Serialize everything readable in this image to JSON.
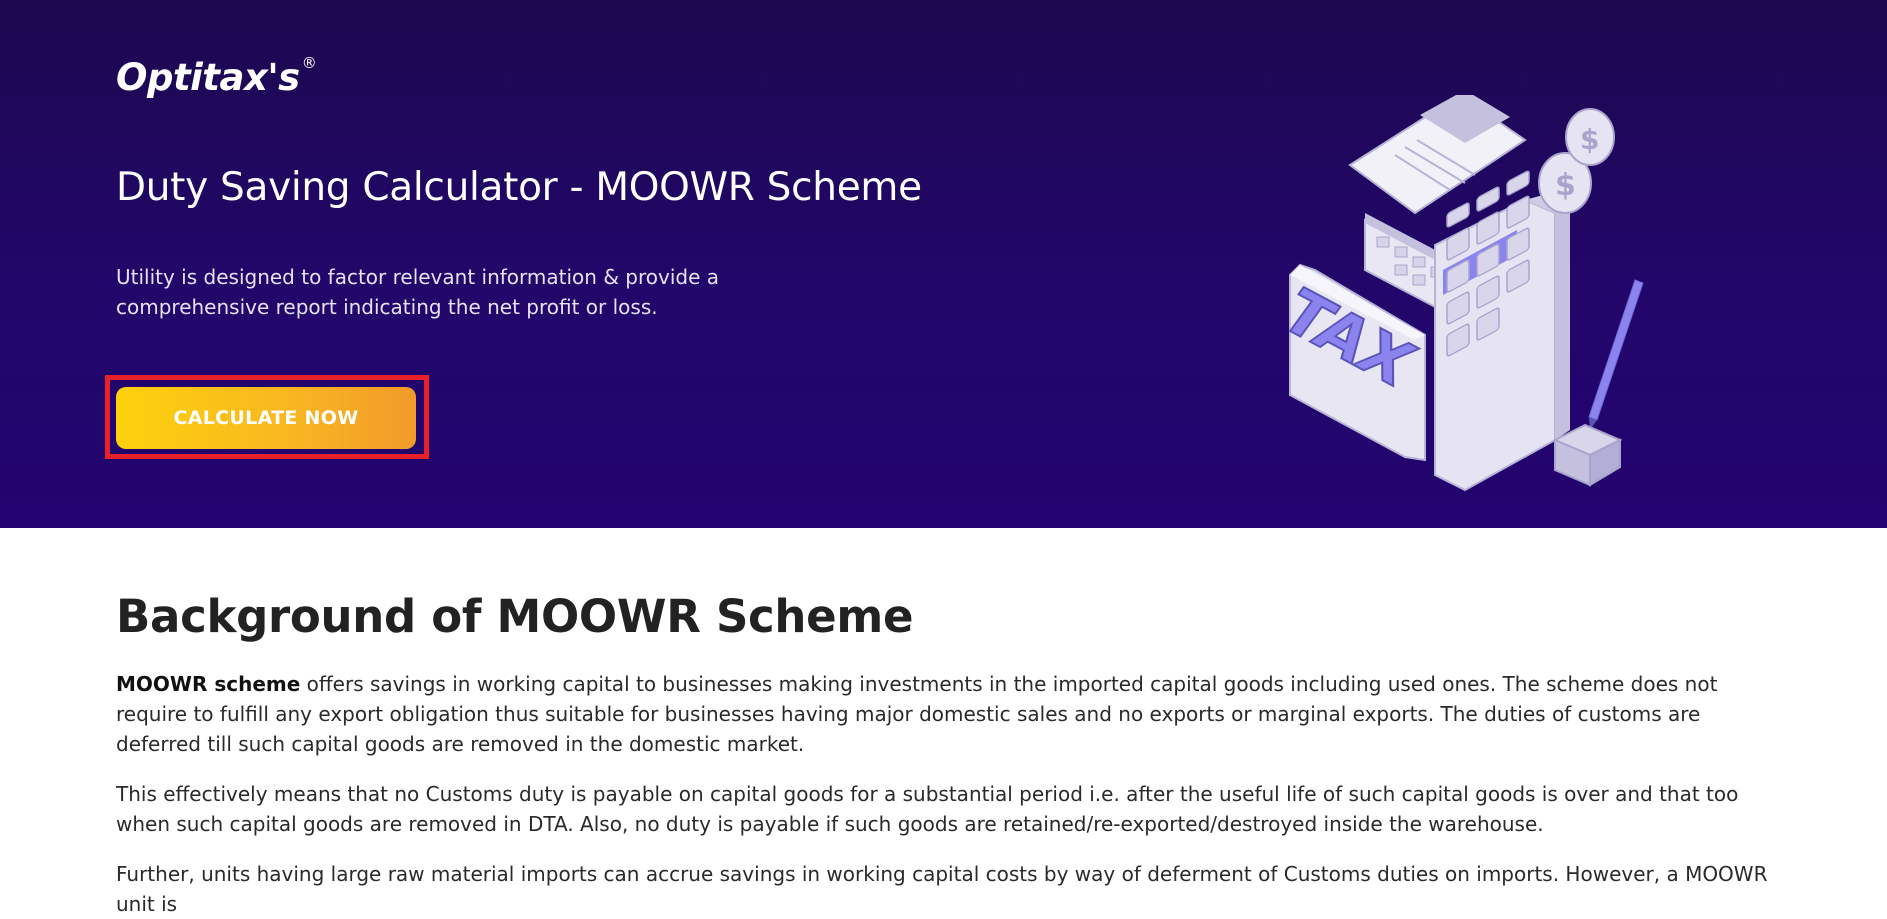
{
  "hero": {
    "logo": "Optitax's",
    "logo_mark": "®",
    "title": "Duty Saving Calculator - MOOWR Scheme",
    "description": "Utility is designed to factor relevant information & provide a comprehensive report indicating the net profit or loss.",
    "cta_label": "CALCULATE NOW",
    "illustration_text": "TAX",
    "illustration_icon": "tax-calculator-illustration",
    "colors": {
      "background": "#1f0658",
      "cta_start": "#fdd10d",
      "cta_end": "#f29a2a",
      "highlight_outline": "#e8202a",
      "illustration_accent": "#8b84ee"
    }
  },
  "content": {
    "section_title": "Background of MOOWR Scheme",
    "p1_bold": "MOOWR scheme",
    "p1_text": " offers savings in working capital to businesses making investments in the imported capital goods including used ones. The scheme does not require to fulfill any export obligation thus suitable for businesses having major domestic sales and no exports or marginal exports. The duties of customs are deferred till such capital goods are removed in the domestic market.",
    "p2_text": "This effectively means that no Customs duty is payable on capital goods for a substantial period i.e. after the useful life of such capital goods is over and that too when such capital goods are removed in DTA. Also, no duty is payable if such goods are retained/re-exported/destroyed inside the warehouse.",
    "p3_text": "Further, units having large raw material imports can accrue savings in working capital costs by way of deferment of Customs duties on imports. However, a MOOWR unit is"
  }
}
